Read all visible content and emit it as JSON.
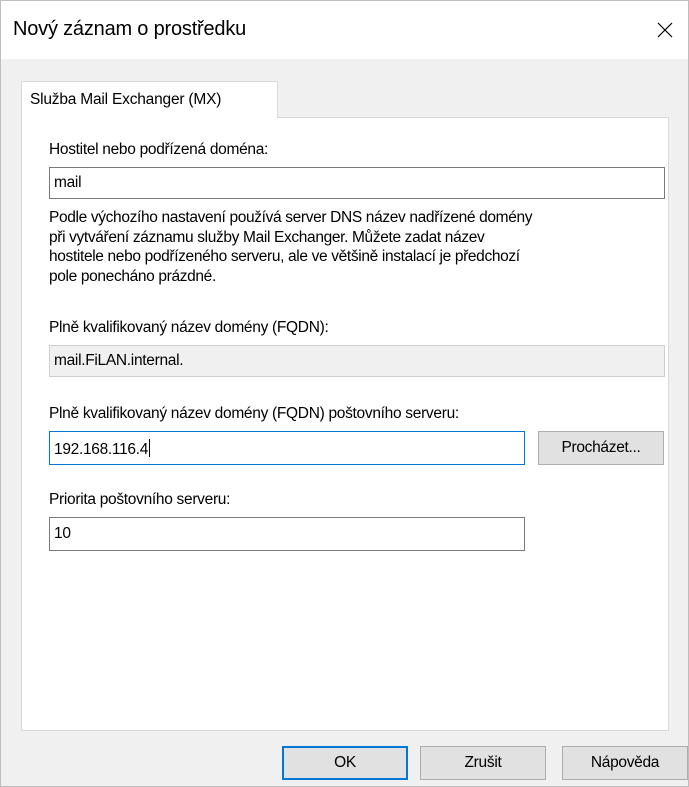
{
  "dialog": {
    "title": "Nový záznam o prostředku",
    "close_icon": "close-icon"
  },
  "tab": {
    "label": "Služba Mail Exchanger (MX)"
  },
  "form": {
    "host_label": "Hostitel nebo podřízená doména:",
    "host_value": "mail",
    "description_lines": [
      "Podle výchozího nastavení používá server DNS název nadřízené domény",
      "při vytváření záznamu služby Mail Exchanger. Můžete zadat název",
      "hostitele nebo podřízeného serveru, ale ve většině instalací je předchozí",
      "pole ponecháno prázdné."
    ],
    "fqdn_label": "Plně kvalifikovaný název domény (FQDN):",
    "fqdn_value": "mail.FiLAN.internal.",
    "mail_server_label": "Plně kvalifikovaný název domény (FQDN) poštovního serveru:",
    "mail_server_value": "192.168.116.4",
    "browse_label": "Procházet...",
    "priority_label": "Priorita poštovního serveru:",
    "priority_value": "10"
  },
  "buttons": {
    "ok": "OK",
    "cancel": "Zrušit",
    "help": "Nápověda"
  },
  "colors": {
    "focus_accent": "#0078d7",
    "dialog_background": "#f0f0f0"
  }
}
